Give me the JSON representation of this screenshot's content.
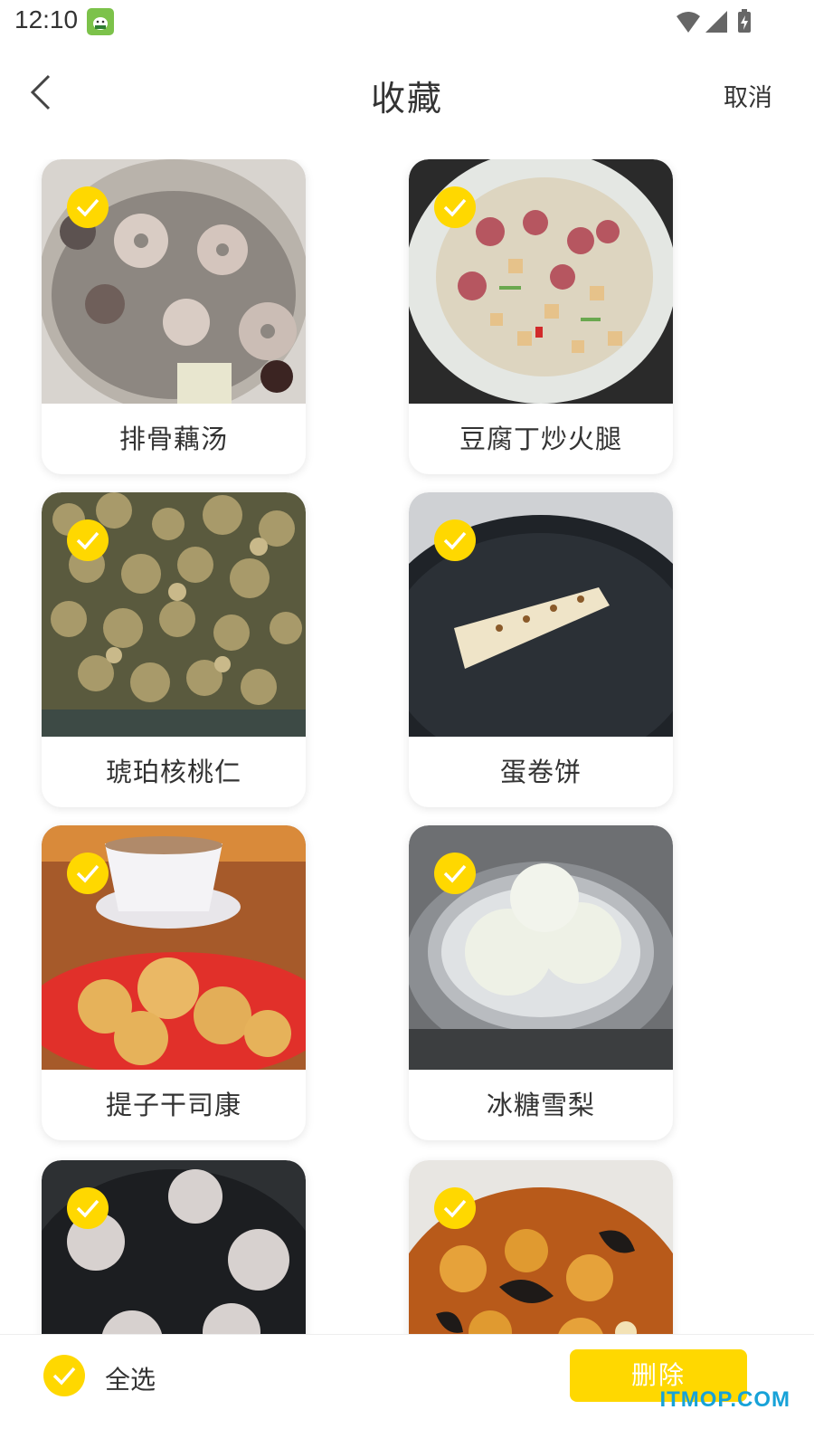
{
  "status_bar": {
    "time": "12:10",
    "icons": [
      "app-notification-icon",
      "wifi-icon",
      "cell-signal-icon",
      "battery-charging-icon"
    ]
  },
  "nav": {
    "title": "收藏",
    "cancel_label": "取消",
    "back_icon": "chevron-left-icon"
  },
  "favorites": [
    {
      "name": "排骨藕汤",
      "selected": true
    },
    {
      "name": "豆腐丁炒火腿",
      "selected": true
    },
    {
      "name": "琥珀核桃仁",
      "selected": true
    },
    {
      "name": "蛋卷饼",
      "selected": true
    },
    {
      "name": "提子干司康",
      "selected": true
    },
    {
      "name": "冰糖雪梨",
      "selected": true
    },
    {
      "name": "",
      "selected": true
    },
    {
      "name": "",
      "selected": true
    }
  ],
  "bottom_bar": {
    "select_all_label": "全选",
    "delete_label": "删除"
  },
  "watermark": "ITMOP.COM",
  "colors": {
    "accent": "#ffd800",
    "watermark": "#17a2d8"
  }
}
